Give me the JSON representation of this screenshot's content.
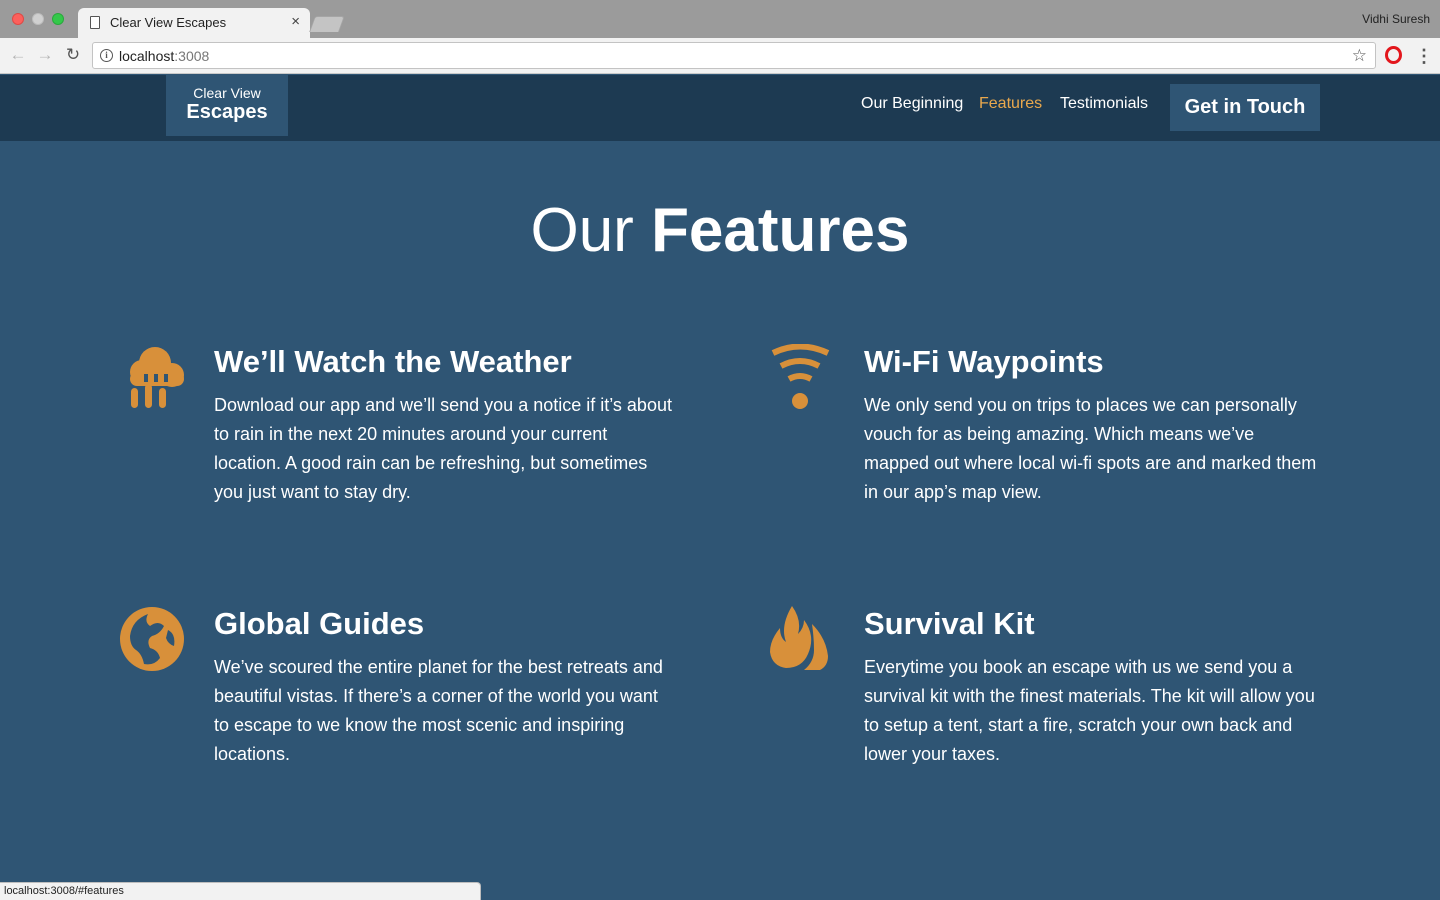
{
  "browser": {
    "tab_title": "Clear View Escapes",
    "close_glyph": "×",
    "profile_name": "Vidhi Suresh",
    "url_host": "localhost",
    "url_port": ":3008",
    "back_glyph": "←",
    "forward_glyph": "→",
    "reload_glyph": "↻",
    "info_glyph": "i",
    "star_glyph": "☆",
    "menu_glyph": "⋮",
    "status_url": "localhost:3008/#features"
  },
  "header": {
    "logo_top": "Clear View",
    "logo_bottom": "Escapes",
    "nav": [
      {
        "label": "Our Beginning"
      },
      {
        "label": "Features"
      },
      {
        "label": "Testimonials"
      }
    ],
    "cta_label": "Get in Touch"
  },
  "main": {
    "title_light": "Our",
    "title_bold": "Features",
    "features": [
      {
        "icon": "rain-cloud-icon",
        "title": "We’ll Watch the Weather",
        "text": "Download our app and we’ll send you a notice if it’s about to rain in the next 20 minutes around your current location. A good rain can be refreshing, but sometimes you just want to stay dry."
      },
      {
        "icon": "wifi-icon",
        "title": "Wi-Fi Waypoints",
        "text": "We only send you on trips to places we can personally vouch for as being amazing. Which means we’ve mapped out where local wi-fi spots are and marked them in our app’s map view."
      },
      {
        "icon": "globe-icon",
        "title": "Global Guides",
        "text": "We’ve scoured the entire planet for the best retreats and beautiful vistas. If there’s a corner of the world you want to escape to we know the most scenic and inspiring locations."
      },
      {
        "icon": "flame-icon",
        "title": "Survival Kit",
        "text": "Everytime you book an escape with us we send you a survival kit with the finest materials. The kit will allow you to setup a tent, start a fire, scratch your own back and lower your taxes."
      }
    ]
  },
  "colors": {
    "page_bg": "#2f5574",
    "header_bg": "#1d3a52",
    "accent": "#e9a84d",
    "icon": "#d8903a"
  }
}
